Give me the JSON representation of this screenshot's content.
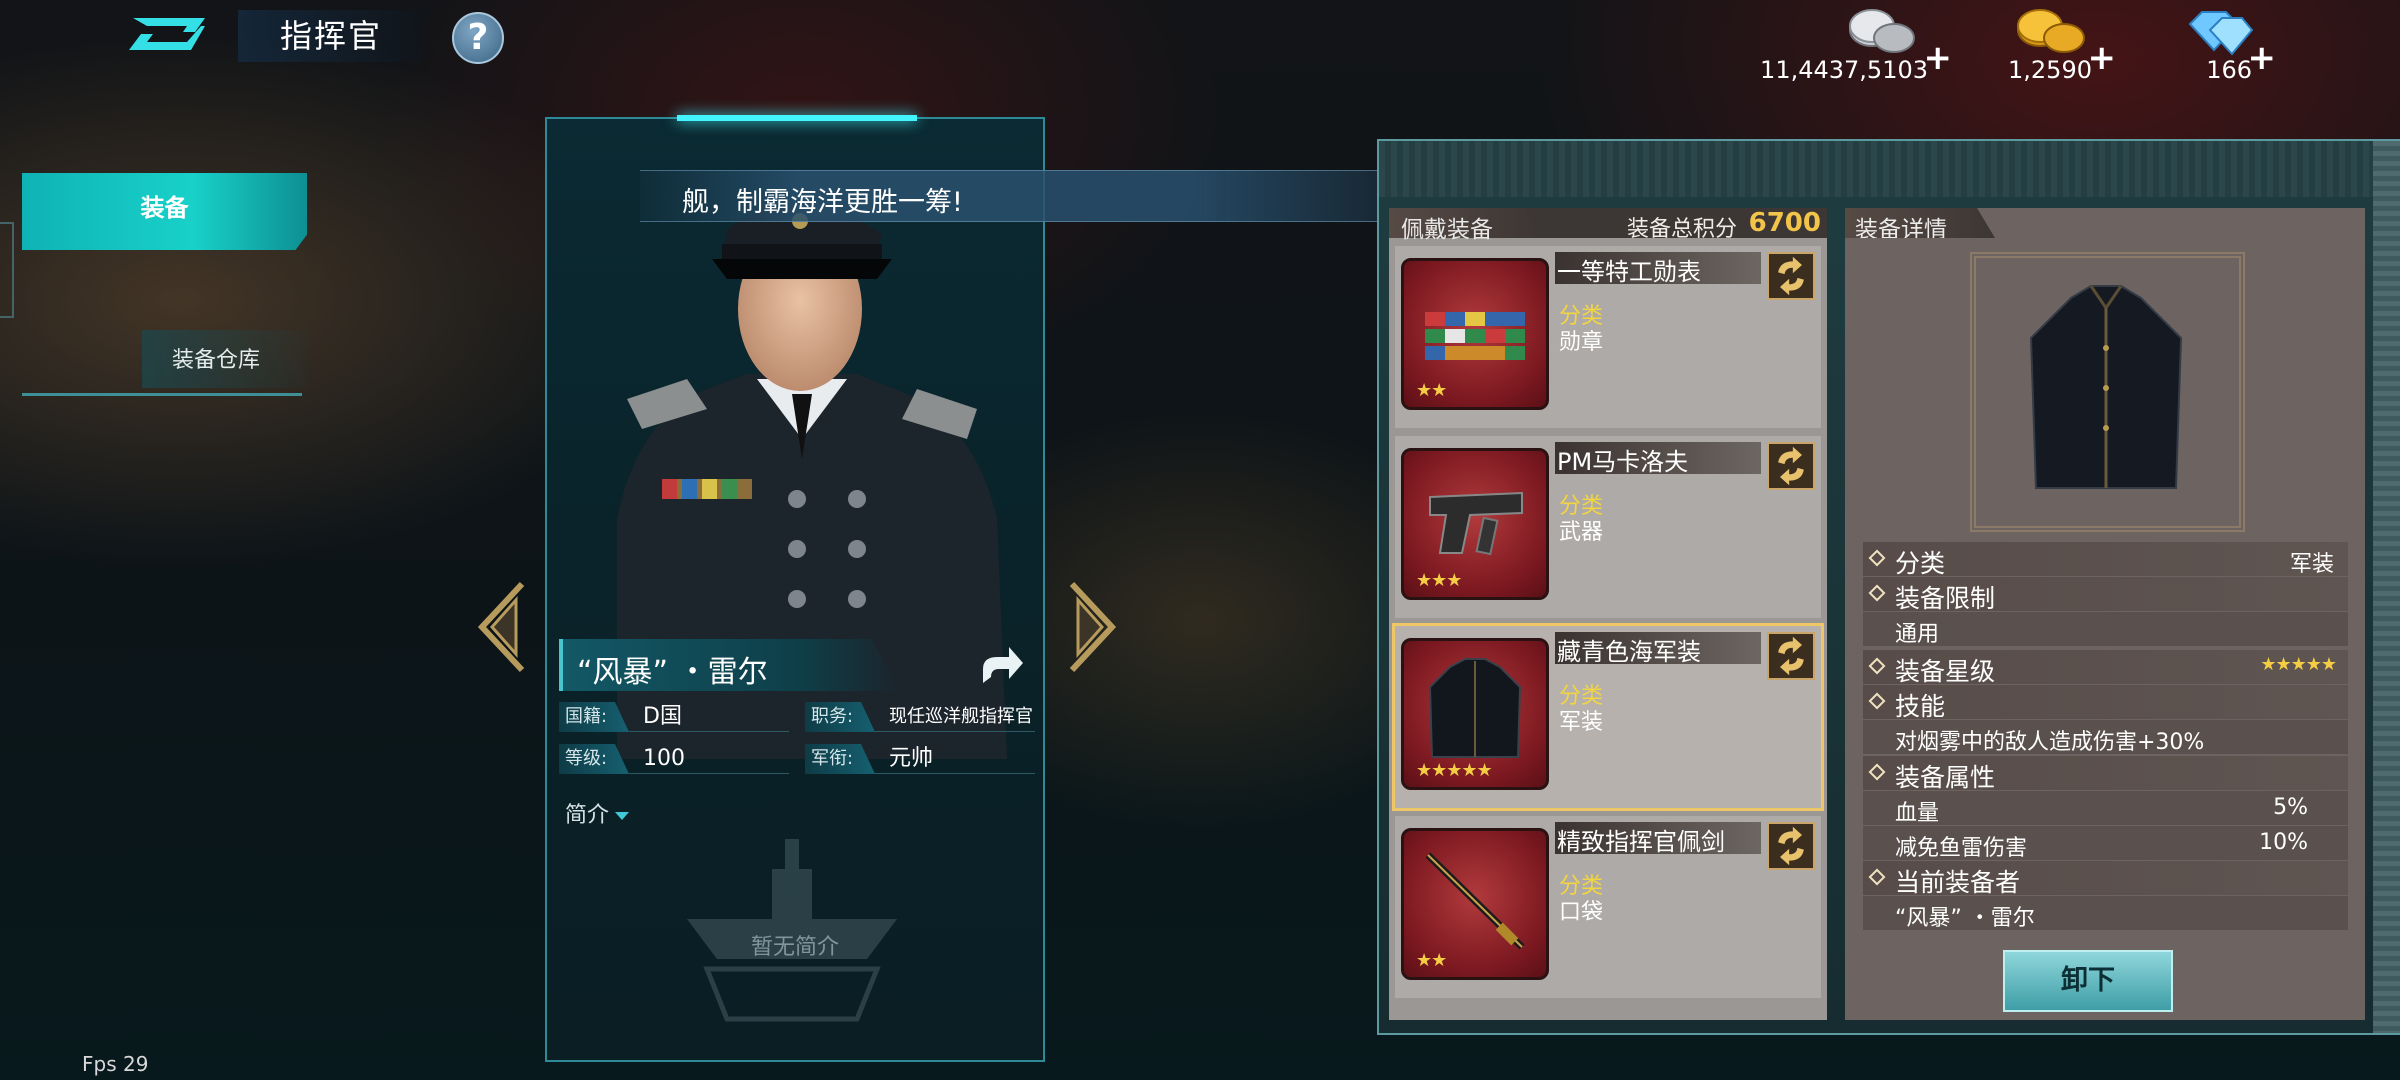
{
  "header": {
    "title": "指挥官",
    "help_label": "?",
    "currencies": [
      {
        "name": "silver-coins",
        "value": "11,4437,5103",
        "plus": "+"
      },
      {
        "name": "gold-coins",
        "value": "1,2590",
        "plus": "+"
      },
      {
        "name": "diamonds",
        "value": "166",
        "plus": "+"
      }
    ]
  },
  "sidebar": {
    "tabs": [
      {
        "label": "装备",
        "active": true
      },
      {
        "label": "装备仓库",
        "active": false
      }
    ]
  },
  "commander": {
    "speech": "舰，制霸海洋更胜一筹!",
    "name": "“风暴” ・雷尔",
    "info": [
      {
        "label": "国籍:",
        "value": "D国"
      },
      {
        "label": "职务:",
        "value": "现任巡洋舰指挥官"
      },
      {
        "label": "等级:",
        "value": "100"
      },
      {
        "label": "军衔:",
        "value": "元帅"
      }
    ],
    "intro_label": "简介",
    "no_intro": "暂无简介"
  },
  "equipped": {
    "header": "佩戴装备",
    "score_label": "装备总积分",
    "score_value": "6700",
    "items": [
      {
        "name": "一等特工勋表",
        "category_label": "分类",
        "category": "勋章",
        "stars": "★★",
        "selected": false
      },
      {
        "name": "PM马卡洛夫",
        "category_label": "分类",
        "category": "武器",
        "stars": "★★★",
        "selected": false
      },
      {
        "name": "藏青色海军装",
        "category_label": "分类",
        "category": "军装",
        "stars": "★★★★★",
        "selected": true
      },
      {
        "name": "精致指挥官佩剑",
        "category_label": "分类",
        "category": "口袋",
        "stars": "★★",
        "selected": false
      }
    ]
  },
  "details": {
    "header": "装备详情",
    "category_label": "分类",
    "category_value": "军装",
    "restriction_label": "装备限制",
    "restriction_value": "通用",
    "star_label": "装备星级",
    "star_value": "★★★★★",
    "skill_label": "技能",
    "skill_value": "对烟雾中的敌人造成伤害+30%",
    "attr_label": "装备属性",
    "attrs": [
      {
        "name": "血量",
        "value": "5%"
      },
      {
        "name": "减免鱼雷伤害",
        "value": "10%"
      }
    ],
    "holder_label": "当前装备者",
    "holder_value": "“风暴” ・雷尔",
    "unequip_label": "卸下"
  },
  "fps": "Fps 29",
  "colors": {
    "accent": "#18d1c9",
    "gold": "#f2c44a",
    "star": "#f5cd45",
    "selected_border": "#f0c766"
  }
}
